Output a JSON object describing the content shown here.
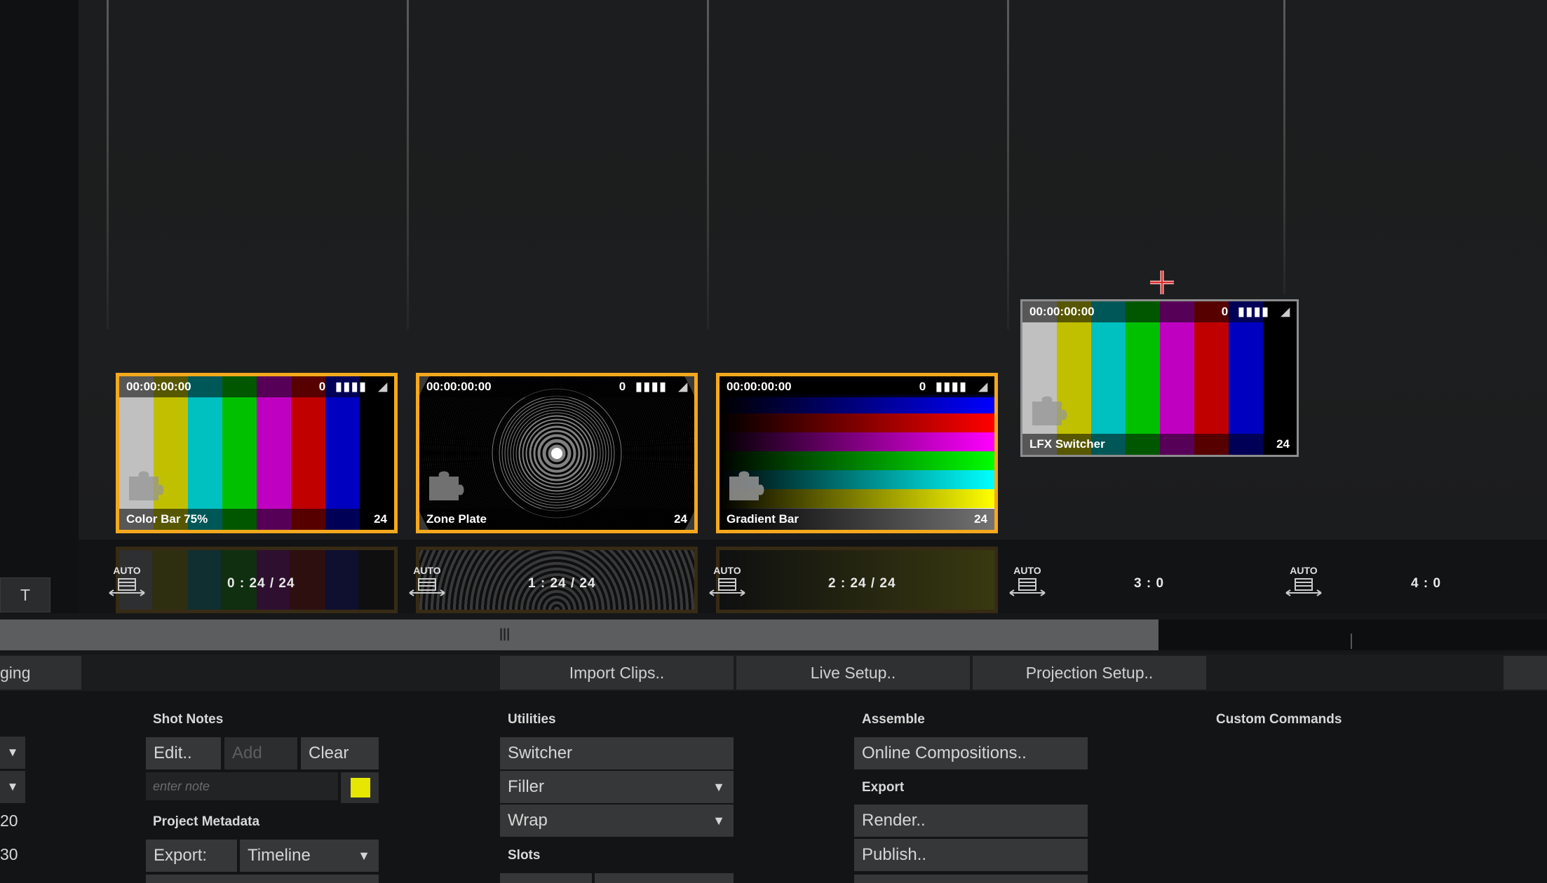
{
  "stage": {
    "t_button": "T",
    "clips": [
      {
        "name": "Color Bar 75%",
        "timecode": "00:00:00:00",
        "count": "0",
        "bars": "▮▮▮▮",
        "frames": "24",
        "colors": [
          "#c0c0c0",
          "#c0c000",
          "#00c0c0",
          "#00c000",
          "#c000c0",
          "#c00000",
          "#0000c0",
          "#000000"
        ],
        "icon": "puzzle-icon"
      },
      {
        "name": "Zone Plate",
        "timecode": "00:00:00:00",
        "count": "0",
        "bars": "▮▮▮▮",
        "frames": "24",
        "icon": "puzzle-icon"
      },
      {
        "name": "Gradient Bar",
        "timecode": "00:00:00:00",
        "count": "0",
        "bars": "▮▮▮▮",
        "frames": "24",
        "icon": "puzzle-icon"
      },
      {
        "name": "LFX Switcher",
        "timecode": "00:00:00:00",
        "count": "0",
        "bars": "▮▮▮▮",
        "frames": "24",
        "colors": [
          "#c0c0c0",
          "#c0c000",
          "#00c0c0",
          "#00c000",
          "#c000c0",
          "#c00000",
          "#0000c0",
          "#000000"
        ],
        "icon": "puzzle-icon"
      }
    ],
    "markers": [
      {
        "label": "AUTO",
        "count": "0 : 24 / 24"
      },
      {
        "label": "AUTO",
        "count": "1 : 24 / 24"
      },
      {
        "label": "AUTO",
        "count": "2 : 24 / 24"
      },
      {
        "label": "AUTO",
        "count": "3 : 0"
      },
      {
        "label": "AUTO",
        "count": "4 : 0"
      }
    ],
    "scroll_grip": "|||"
  },
  "toolbar": {
    "left_tab": "ging",
    "import_clips": "Import Clips..",
    "live_setup": "Live Setup..",
    "projection_setup": "Projection Setup.."
  },
  "panel": {
    "left_values": [
      "20",
      "30"
    ],
    "shot_notes": {
      "title": "Shot Notes",
      "edit": "Edit..",
      "add": "Add",
      "clear": "Clear",
      "note_placeholder": "enter note",
      "note_color": "#e6e600"
    },
    "project_metadata": {
      "title": "Project Metadata",
      "export_label": "Export:",
      "export_value": "Timeline"
    },
    "utilities": {
      "title": "Utilities",
      "switcher": "Switcher",
      "filler": "Filler",
      "wrap": "Wrap",
      "slots_title": "Slots"
    },
    "assemble": {
      "title": "Assemble",
      "online_compositions": "Online Compositions..",
      "export_title": "Export",
      "render": "Render..",
      "publish": "Publish.."
    },
    "custom_commands": {
      "title": "Custom Commands"
    }
  },
  "colors": {
    "selection": "#f4a81d",
    "accent": "#e6e600"
  }
}
